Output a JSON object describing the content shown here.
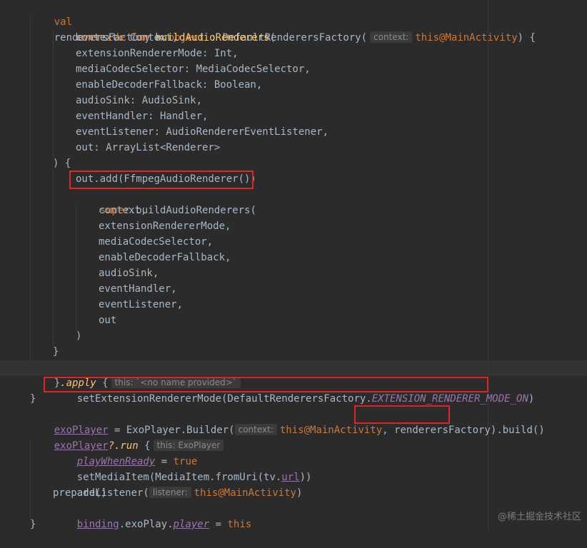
{
  "editor": {
    "lines": {
      "l1": {
        "val": "val",
        "name": "renderersFactory",
        "eq": " = ",
        "object": "object",
        "colon": " : ",
        "cls": "DefaultRenderersFactory(",
        "hint": "context:",
        "this": "this@MainActivity",
        "tail": ") {"
      },
      "l2": {
        "override": "override",
        "fun": "fun",
        "name": "buildAudioRenderers",
        "paren": "("
      },
      "l3": "context: Context,",
      "l4": "extensionRendererMode: Int,",
      "l5": "mediaCodecSelector: MediaCodecSelector,",
      "l6": "enableDecoderFallback: Boolean,",
      "l7": "audioSink: AudioSink,",
      "l8": "eventHandler: Handler,",
      "l9": "eventListener: AudioRendererEventListener,",
      "l10": "out: ArrayList<Renderer>",
      "l11": ") {",
      "l12": "out.add(FfmpegAudioRenderer())",
      "l13": {
        "super": "super",
        "rest": ".buildAudioRenderers("
      },
      "l14": "context,",
      "l15": "extensionRendererMode,",
      "l16": "mediaCodecSelector,",
      "l17": "enableDecoderFallback,",
      "l18": "audioSink,",
      "l19": "eventHandler,",
      "l20": "eventListener,",
      "l21": "out",
      "l22": ")",
      "l23": "}",
      "l24": {
        "brace": "}",
        "apply": ".apply",
        "open": " {",
        "hint": "this: `<no name provided>`"
      },
      "l25": {
        "call": "setExtensionRendererMode(DefaultRenderersFactory.",
        "const": "EXTENSION_RENDERER_MODE_ON",
        "close": ")"
      },
      "l26": "}",
      "l27": {
        "var": "exoPlayer",
        "eq": " = ExoPlayer.Builder(",
        "hint": "context:",
        "this": "this@MainActivity",
        "comma": ", ",
        "arg": "renderersFactory",
        "tail": ").build()"
      },
      "l28": {
        "var": "exoPlayer",
        "run": "?.run",
        "open": " {",
        "hint": "this: ExoPlayer"
      },
      "l29": {
        "prop": "playWhenReady",
        "eq": " = ",
        "val": "true"
      },
      "l30": {
        "pre": "setMediaItem(MediaItem.fromUri(tv.",
        "prop": "url",
        "post": "))"
      },
      "l31": {
        "pre": "addListener(",
        "hint": "listener:",
        "this": "this@MainActivity",
        "post": ")"
      },
      "l32": "prepare()",
      "l33": {
        "obj": "binding",
        "dot": ".exoPlay.",
        "prop": "player",
        "eq": " = ",
        "this": "this"
      },
      "l34": "}"
    },
    "colors": {
      "background": "#2b2b2b",
      "keyword": "#cc7832",
      "function": "#ffc66d",
      "property": "#9876aa",
      "text": "#a9b7c6",
      "highlight_box": "#e02424"
    }
  },
  "watermark": "@稀土掘金技术社区"
}
